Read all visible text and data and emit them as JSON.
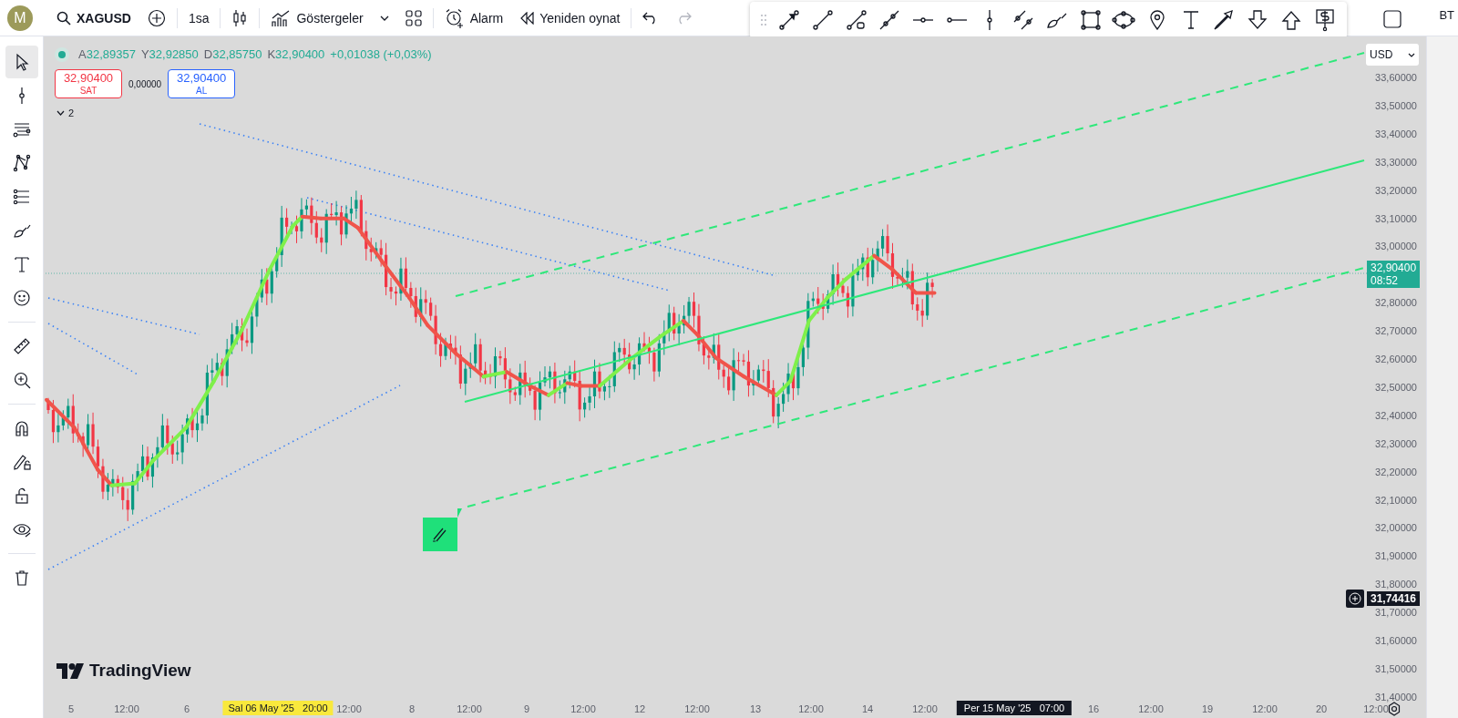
{
  "top_bar": {
    "avatar": "M",
    "symbol": "XAGUSD",
    "interval": "1sa",
    "indicators": "Göstergeler",
    "alert": "Alarm",
    "replay": "Yeniden oynat",
    "undo": {
      "disabled": false
    },
    "redo": {
      "disabled": true
    },
    "account": "BT"
  },
  "left_toolbar": {
    "tools": [
      {
        "kind": "cursor",
        "selected": true
      },
      {
        "kind": "cross",
        "selected": false
      },
      {
        "kind": "lines",
        "selected": false
      },
      {
        "kind": "pattern",
        "selected": false
      },
      {
        "kind": "fib",
        "selected": false
      },
      {
        "kind": "brush",
        "selected": false
      },
      {
        "kind": "text",
        "selected": false
      },
      {
        "kind": "smiley",
        "selected": false
      },
      {
        "kind": "ruler",
        "selected": false
      },
      {
        "kind": "zoom",
        "selected": false
      },
      {
        "kind": "magnet",
        "selected": false
      },
      {
        "kind": "pencil-lock",
        "selected": false
      },
      {
        "kind": "lock",
        "selected": false
      },
      {
        "kind": "eye",
        "selected": false
      },
      {
        "kind": "trash",
        "selected": false
      }
    ]
  },
  "legend": {
    "fields": [
      {
        "label": "A",
        "value": "32,89357"
      },
      {
        "label": "Y",
        "value": "32,92850"
      },
      {
        "label": "D",
        "value": "32,85750"
      },
      {
        "label": "K",
        "value": "32,90400"
      }
    ],
    "change": "+0,01038 (+0,03%)"
  },
  "order_panel": {
    "sell": {
      "price": "32,90400",
      "label": "SAT"
    },
    "spread": "0,00000",
    "buy": {
      "price": "32,90400",
      "label": "AL"
    }
  },
  "indicators_toggle": {
    "count": "2"
  },
  "price_axis": {
    "currency": "USD",
    "ticks": [
      "33,60000",
      "33,50000",
      "33,40000",
      "33,30000",
      "33,20000",
      "33,10000",
      "33,00000",
      "32,80000",
      "32,70000",
      "32,60000",
      "32,50000",
      "32,40000",
      "32,30000",
      "32,20000",
      "32,10000",
      "32,00000",
      "31,90000",
      "31,80000",
      "31,70000",
      "31,60000",
      "31,50000",
      "31,40000"
    ],
    "last_price": {
      "price": "32,90400",
      "countdown": "08:52"
    },
    "crosshair_price": "31,74416"
  },
  "time_axis": {
    "labels": [
      {
        "text": "5",
        "kind": "tick"
      },
      {
        "text": "12:00",
        "kind": "tick"
      },
      {
        "text": "6",
        "kind": "tick"
      },
      {
        "text": "Sal 06 May '25   20:00",
        "kind": "highlight"
      },
      {
        "text": "12:00",
        "kind": "tick"
      },
      {
        "text": "8",
        "kind": "tick"
      },
      {
        "text": "12:00",
        "kind": "tick"
      },
      {
        "text": "9",
        "kind": "tick"
      },
      {
        "text": "12:00",
        "kind": "tick"
      },
      {
        "text": "12",
        "kind": "tick"
      },
      {
        "text": "12:00",
        "kind": "tick"
      },
      {
        "text": "13",
        "kind": "tick"
      },
      {
        "text": "12:00",
        "kind": "tick"
      },
      {
        "text": "14",
        "kind": "tick"
      },
      {
        "text": "12:00",
        "kind": "tick"
      },
      {
        "text": "Per 15 May '25   07:00",
        "kind": "cursor"
      },
      {
        "text": "16",
        "kind": "tick"
      },
      {
        "text": "12:00",
        "kind": "tick"
      },
      {
        "text": "19",
        "kind": "tick"
      },
      {
        "text": "12:00",
        "kind": "tick"
      },
      {
        "text": "20",
        "kind": "tick"
      },
      {
        "text": "12:00",
        "kind": "tick"
      }
    ]
  },
  "brand": "TradingView"
}
